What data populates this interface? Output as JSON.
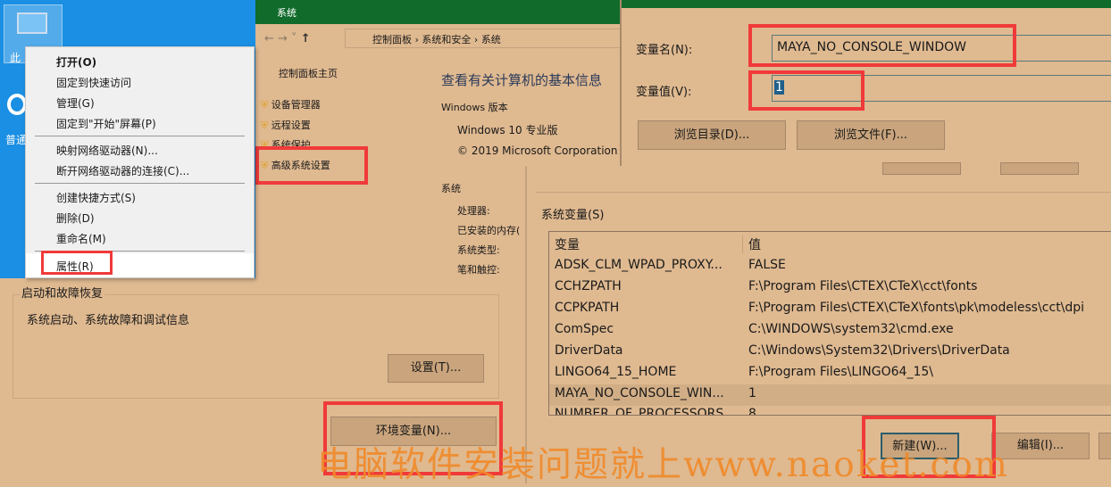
{
  "desktop": {
    "icons": [
      {
        "label": "此"
      },
      {
        "label": "普通"
      }
    ]
  },
  "context_menu": {
    "items": [
      "打开(O)",
      "固定到快速访问",
      "管理(G)",
      "固定到\"开始\"屏幕(P)",
      "映射网络驱动器(N)...",
      "断开网络驱动器的连接(C)...",
      "创建快捷方式(S)",
      "删除(D)",
      "重命名(M)",
      "属性(R)"
    ]
  },
  "system_window": {
    "title": "系统",
    "breadcrumb": [
      "控制面板",
      "系统和安全",
      "系统"
    ],
    "left_pane": {
      "home": "控制面板主页",
      "links": [
        "设备管理器",
        "远程设置",
        "系统保护",
        "高级系统设置"
      ]
    },
    "heading": "查看有关计算机的基本信息",
    "windows_edition_label": "Windows 版本",
    "edition": "Windows 10 专业版",
    "copyright": "© 2019 Microsoft Corporation。",
    "system_label": "系统",
    "system_fields": [
      "处理器:",
      "已安装的内存(",
      "系统类型:",
      "笔和触控:"
    ]
  },
  "startup_group": {
    "title": "启动和故障恢复",
    "desc": "系统启动、系统故障和调试信息",
    "settings_button": "设置(T)..."
  },
  "env_button": "环境变量(N)...",
  "new_var_dialog": {
    "name_label": "变量名(N):",
    "name_value": "MAYA_NO_CONSOLE_WINDOW",
    "value_label": "变量值(V):",
    "value_value": "1",
    "browse_dir": "浏览目录(D)...",
    "browse_file": "浏览文件(F)..."
  },
  "env_dialog": {
    "system_vars_label": "系统变量(S)",
    "columns": [
      "变量",
      "值"
    ],
    "rows": [
      [
        "ADSK_CLM_WPAD_PROXY...",
        "FALSE"
      ],
      [
        "CCHZPATH",
        "F:\\Program Files\\CTEX\\CTeX\\cct\\fonts"
      ],
      [
        "CCPKPATH",
        "F:\\Program Files\\CTEX\\CTeX\\fonts\\pk\\modeless\\cct\\dpi"
      ],
      [
        "ComSpec",
        "C:\\WINDOWS\\system32\\cmd.exe"
      ],
      [
        "DriverData",
        "C:\\Windows\\System32\\Drivers\\DriverData"
      ],
      [
        "LINGO64_15_HOME",
        "F:\\Program Files\\LINGO64_15\\"
      ],
      [
        "MAYA_NO_CONSOLE_WIN...",
        "1"
      ],
      [
        "NUMBER_OF_PROCESSORS",
        "8"
      ]
    ],
    "new_button": "新建(W)...",
    "edit_button": "编辑(I)..."
  },
  "watermark": "电脑软件安装问题就上www.naoket.com",
  "colors": {
    "highlight": "#f03a3a",
    "titlebar": "#116b2b",
    "desktop": "#1a8fe3",
    "background": "#dfb990"
  }
}
